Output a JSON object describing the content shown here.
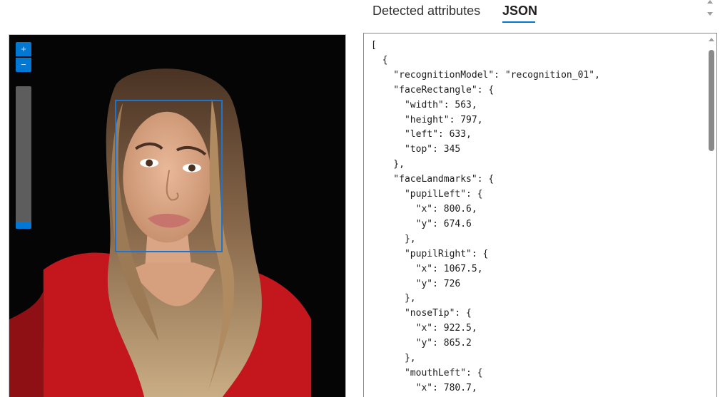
{
  "tabs": [
    {
      "label": "Detected attributes"
    },
    {
      "label": "JSON"
    }
  ],
  "viewer": {
    "zoom_in_label": "+",
    "zoom_out_label": "−",
    "zoom_level": 0.05
  },
  "json_output": "[\n  {\n    \"recognitionModel\": \"recognition_01\",\n    \"faceRectangle\": {\n      \"width\": 563,\n      \"height\": 797,\n      \"left\": 633,\n      \"top\": 345\n    },\n    \"faceLandmarks\": {\n      \"pupilLeft\": {\n        \"x\": 800.6,\n        \"y\": 674.6\n      },\n      \"pupilRight\": {\n        \"x\": 1067.5,\n        \"y\": 726\n      },\n      \"noseTip\": {\n        \"x\": 922.5,\n        \"y\": 865.2\n      },\n      \"mouthLeft\": {\n        \"x\": 780.7,"
}
